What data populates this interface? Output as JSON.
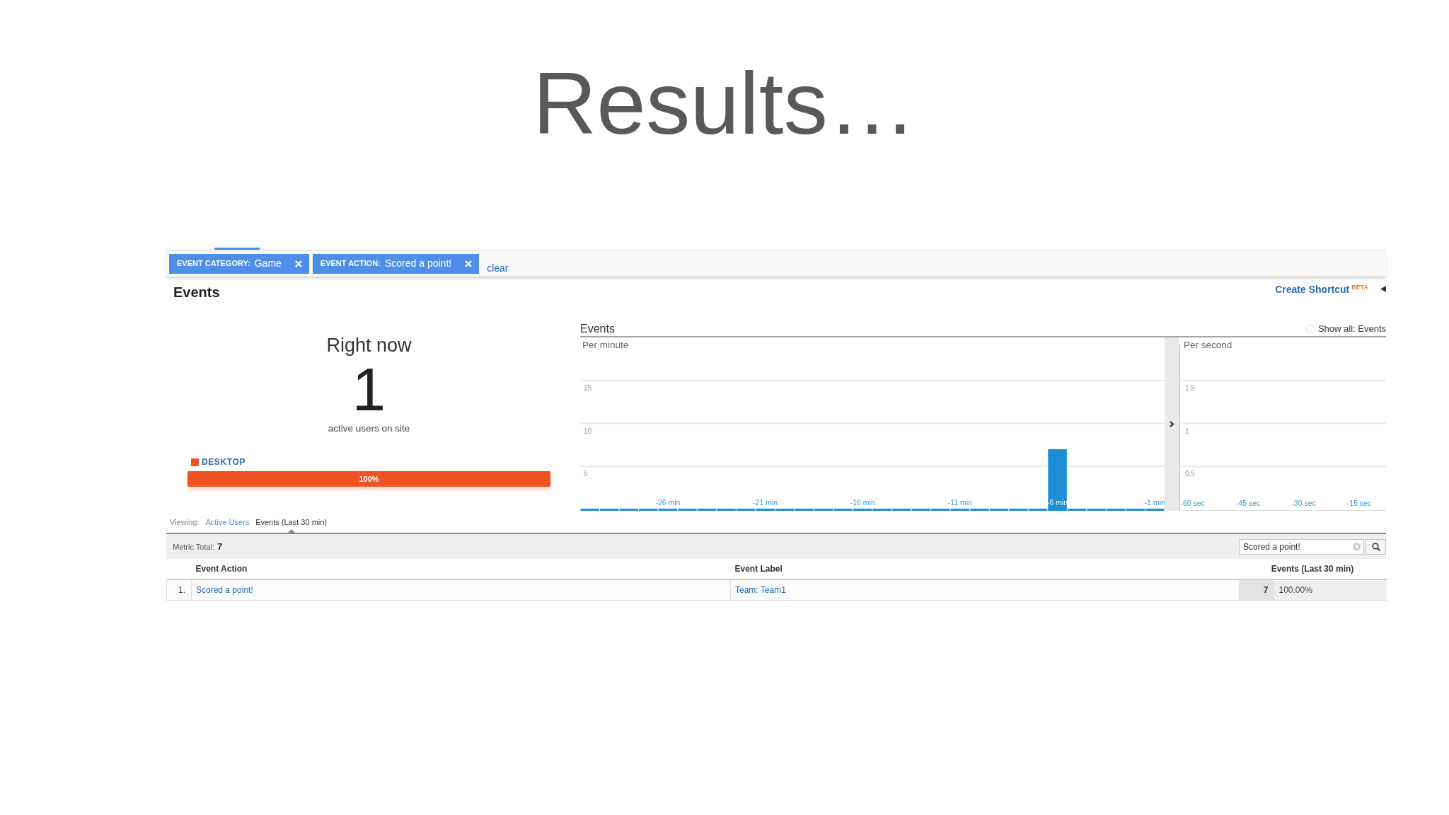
{
  "slide": {
    "title": "Results…"
  },
  "filters": [
    {
      "label": "EVENT CATEGORY:",
      "value": "Game"
    },
    {
      "label": "EVENT ACTION:",
      "value": "Scored a point!"
    }
  ],
  "clear_link": "clear",
  "report": {
    "title": "Events",
    "shortcut": {
      "label": "Create Shortcut",
      "badge": "BETA"
    }
  },
  "right_now": {
    "heading": "Right now",
    "count": "1",
    "caption": "active users on site",
    "devices": [
      {
        "label": "DESKTOP",
        "level": 1,
        "reading": "100%"
      }
    ]
  },
  "events_chart": {
    "title": "Events",
    "show_all": {
      "label": "Show all: Events",
      "checked": false
    },
    "chart_data": [
      {
        "type": "bar",
        "title": "Per minute",
        "categories": [
          null,
          null,
          null,
          null,
          "-26 min",
          null,
          null,
          null,
          null,
          "-21 min",
          null,
          null,
          null,
          null,
          "-16 min",
          null,
          null,
          null,
          null,
          "-11 min",
          null,
          null,
          null,
          null,
          "-6 min",
          null,
          null,
          null,
          null,
          "-1 min"
        ],
        "values": [
          0,
          0,
          0,
          0,
          0,
          0,
          0,
          0,
          0,
          0,
          0,
          0,
          0,
          0,
          0,
          0,
          0,
          0,
          0,
          0,
          0,
          0,
          0,
          0,
          7,
          0,
          0,
          0,
          0,
          0
        ],
        "color": "#1b8ed6",
        "ylim": [
          0,
          20
        ],
        "yticks": [
          5,
          10,
          15
        ],
        "grid": true
      },
      {
        "type": "bar",
        "title": "Per second",
        "xlim": [
          -63.75,
          -7.75
        ],
        "xticks": [
          {
            "value": -60,
            "label": "-60 sec"
          },
          {
            "value": -45,
            "label": "-45 sec"
          },
          {
            "value": -30,
            "label": "-30 sec"
          },
          {
            "value": -15,
            "label": "-15 sec"
          }
        ],
        "ylim": [
          0,
          2
        ],
        "yticks": [
          0.5,
          1,
          1.5
        ],
        "grid": true
      }
    ]
  },
  "viewing": {
    "label": "Viewing:",
    "options": [
      {
        "label": "Active Users",
        "selected": false
      },
      {
        "label": "Events (Last 30 min)",
        "selected": true
      }
    ]
  },
  "table": {
    "metric_total": {
      "label": "Metric Total:",
      "value": "7"
    },
    "search": {
      "value": "Scored a point!"
    },
    "columns": [
      "Event Action",
      "Event Label",
      "Events (Last 30 min)"
    ],
    "rows": [
      {
        "number": "1.",
        "event_action": "Scored a point!",
        "event_label": "Team: Team1",
        "events": "7",
        "share": "100.00%"
      }
    ]
  }
}
